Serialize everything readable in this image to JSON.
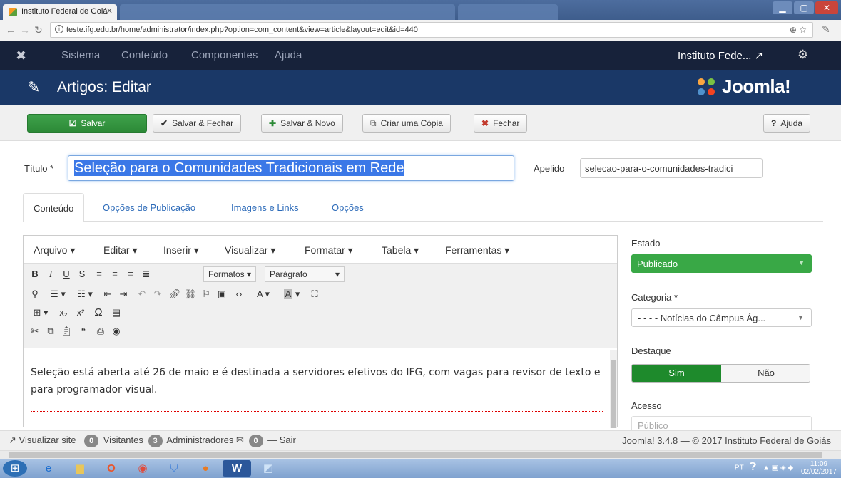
{
  "browser": {
    "active_tab": "Instituto Federal de Goiá",
    "url": "teste.ifg.edu.br/home/administrator/index.php?option=com_content&view=article&layout=edit&id=440"
  },
  "topnav": {
    "items": [
      "Sistema",
      "Conteúdo",
      "Componentes",
      "Ajuda"
    ],
    "site": "Instituto Fede... ↗"
  },
  "header": {
    "title": "Artigos: Editar",
    "brand": "Joomla!"
  },
  "toolbar": {
    "save": "Salvar",
    "save_close": "Salvar & Fechar",
    "save_new": "Salvar & Novo",
    "save_copy": "Criar uma Cópia",
    "close": "Fechar",
    "help": "Ajuda"
  },
  "form": {
    "title_label": "Título *",
    "title_value": "Seleção para o Comunidades Tradicionais em Rede",
    "alias_label": "Apelido",
    "alias_value": "selecao-para-o-comunidades-tradici"
  },
  "tabs": [
    "Conteúdo",
    "Opções de Publicação",
    "Imagens e Links",
    "Opções"
  ],
  "editor": {
    "menu": [
      "Arquivo ▾",
      "Editar ▾",
      "Inserir ▾",
      "Visualizar ▾",
      "Formatar ▾",
      "Tabela ▾",
      "Ferramentas ▾"
    ],
    "formats": "Formatos ▾",
    "paragraph": "Parágrafo",
    "body": "Seleção está aberta até 26 de maio e é destinada a servidores efetivos do IFG, com vagas para revisor de texto e para programador visual."
  },
  "sidebar": {
    "estado_label": "Estado",
    "estado_value": "Publicado",
    "categoria_label": "Categoria *",
    "categoria_value": "- - - - Notícias do Câmpus Ág...",
    "destaque_label": "Destaque",
    "destaque_yes": "Sim",
    "destaque_no": "Não",
    "acesso_label": "Acesso",
    "acesso_value": "Público"
  },
  "statusbar": {
    "view_site": "Visualizar site",
    "visitors_count": "0",
    "visitors_label": "Visitantes",
    "admins_count": "3",
    "admins_label": "Administradores",
    "messages_count": "0",
    "logout": "Sair",
    "version": "Joomla! 3.4.8 — © 2017 Instituto Federal de Goiás"
  },
  "taskbar": {
    "lang": "PT",
    "time": "11:09",
    "date": "02/02/2017"
  },
  "colors": {
    "navbar": "#17223a",
    "header": "#1a3867",
    "save_green": "#2c8a37",
    "estado_green": "#39a846"
  }
}
